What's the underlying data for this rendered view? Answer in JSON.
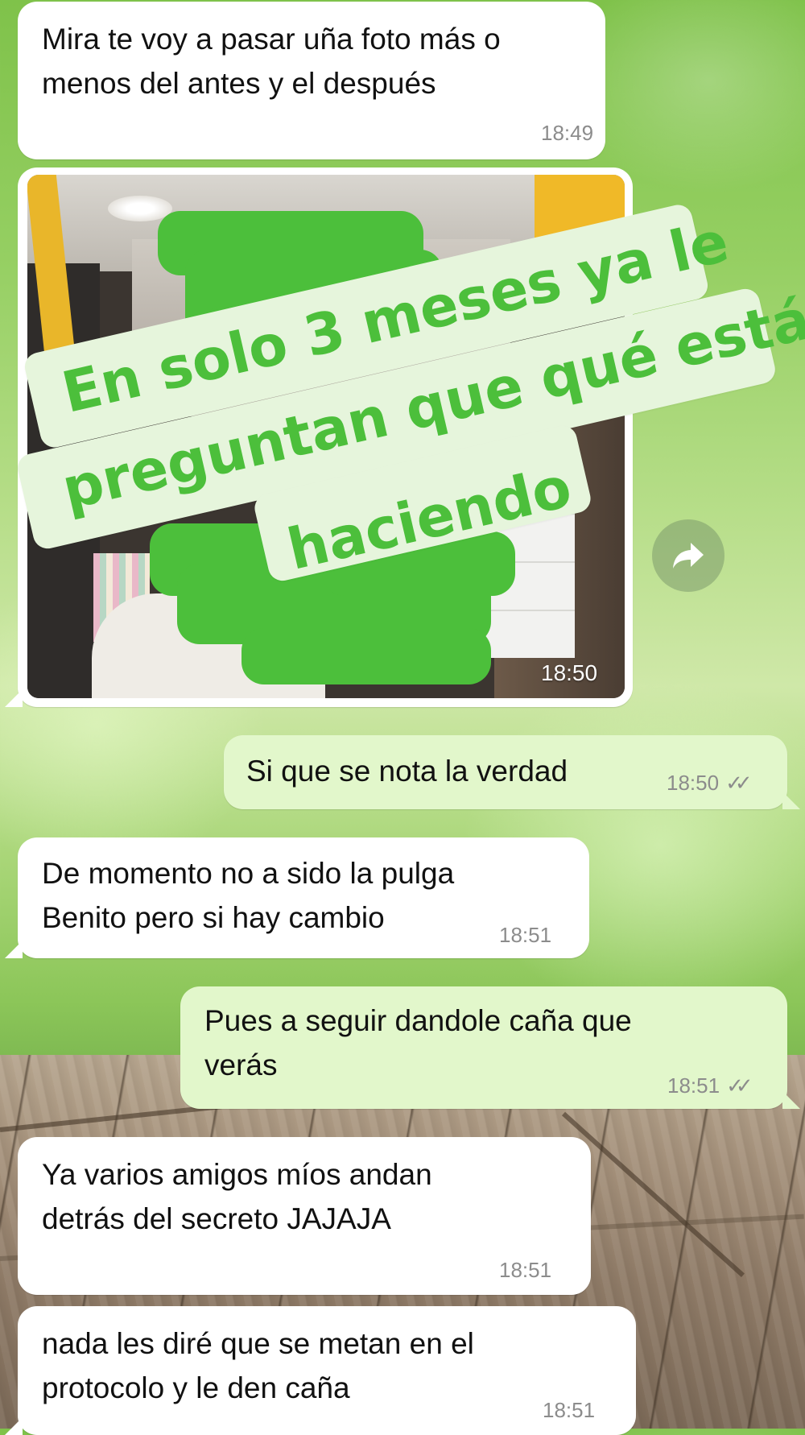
{
  "overlay_caption": {
    "line1": "En solo 3 meses ya le",
    "line2": "preguntan que qué está",
    "line3": "haciendo",
    "color": "#4cbf3b"
  },
  "messages": [
    {
      "direction": "incoming",
      "line1": "Mira te voy a pasar uña foto más o",
      "line2": "menos del antes y el después",
      "time": "18:49"
    },
    {
      "direction": "incoming",
      "type": "photo",
      "time": "18:50"
    },
    {
      "direction": "outgoing",
      "line1": "Si que se nota la verdad",
      "time": "18:50",
      "status": "read"
    },
    {
      "direction": "incoming",
      "line1": "De momento no a sido la pulga",
      "line2": "Benito pero si hay cambio",
      "time": "18:51"
    },
    {
      "direction": "outgoing",
      "line1": "Pues a seguir dandole caña que",
      "line2": "verás",
      "time": "18:51",
      "status": "read"
    },
    {
      "direction": "incoming",
      "line1": "Ya varios amigos míos andan",
      "line2": "detrás del secreto JAJAJA",
      "time": "18:51"
    },
    {
      "direction": "incoming",
      "line1": "nada les diré que se metan en el",
      "line2": "protocolo y le den caña",
      "time": "18:51"
    }
  ],
  "icons": {
    "forward": "forward-arrow-icon",
    "read_receipt": "double-check-icon"
  },
  "colors": {
    "incoming_bubble": "#ffffff",
    "outgoing_bubble": "#e2f7cb",
    "timestamp": "#8c8c8c",
    "censor_blob": "#4cbf3b"
  }
}
